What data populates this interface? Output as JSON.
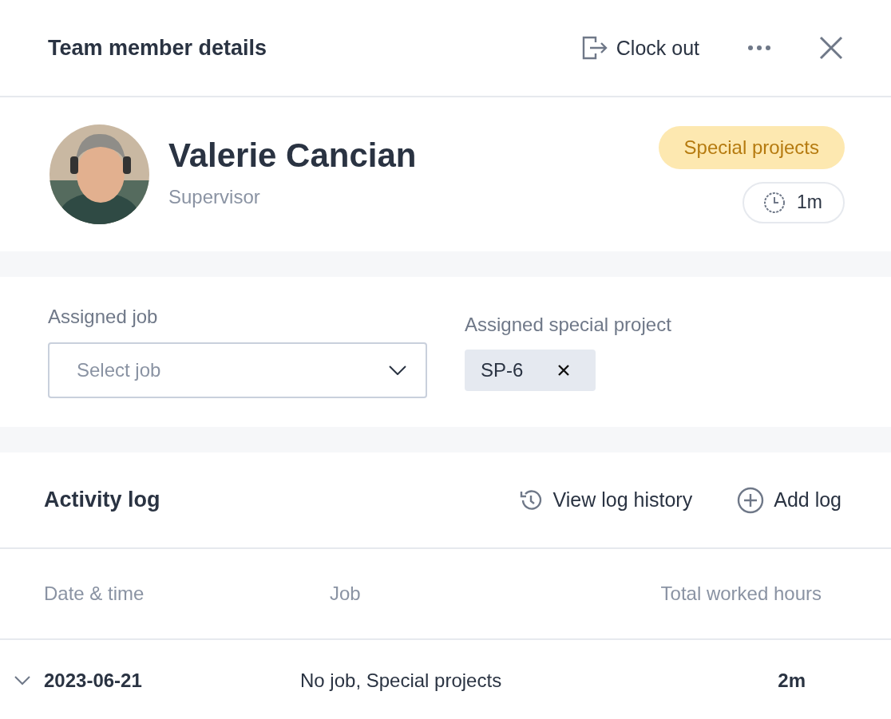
{
  "header": {
    "title": "Team member details",
    "clock_out": "Clock out"
  },
  "profile": {
    "name": "Valerie Cancian",
    "role": "Supervisor",
    "status_badge": "Special projects",
    "duration": "1m"
  },
  "assignment": {
    "job_label": "Assigned job",
    "job_placeholder": "Select job",
    "project_label": "Assigned special project",
    "project_chips": [
      {
        "label": "SP-6"
      }
    ]
  },
  "activity": {
    "title": "Activity log",
    "view_history": "View log history",
    "add_log": "Add log",
    "columns": [
      "Date & time",
      "Job",
      "Total worked hours"
    ],
    "rows": [
      {
        "date": "2023-06-21",
        "job": "No job, Special projects",
        "hours": "2m",
        "expanded": false
      }
    ]
  }
}
